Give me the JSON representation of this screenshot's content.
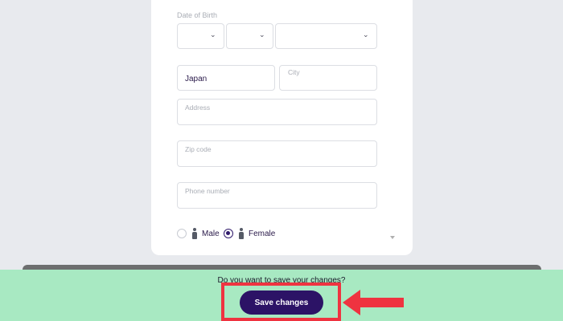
{
  "form": {
    "date_of_birth_label": "Date of Birth",
    "country_value": "Japan",
    "city_label": "City",
    "address_label": "Address",
    "zip_label": "Zip code",
    "phone_label": "Phone number",
    "gender": {
      "male_label": "Male",
      "female_label": "Female",
      "selected": "Female"
    }
  },
  "save_bar": {
    "question": "Do you want to save your changes?",
    "save_button_label": "Save changes"
  },
  "colors": {
    "accent": "#2c1366",
    "save_bar": "#a8e9c2",
    "highlight": "#ef3340"
  }
}
